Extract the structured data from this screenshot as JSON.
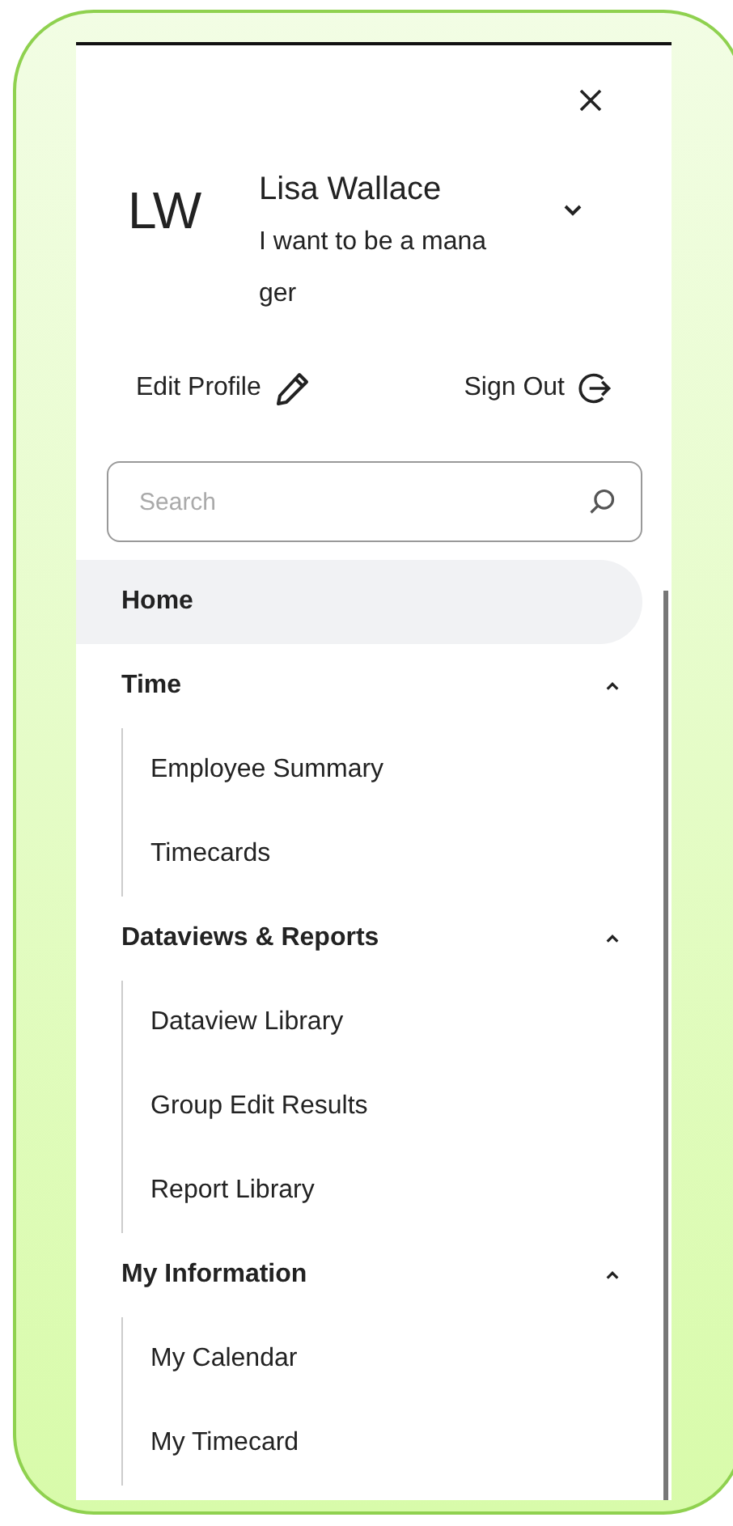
{
  "profile": {
    "initials": "LW",
    "name": "Lisa Wallace",
    "subtitle": "I want to be a manager",
    "expanded": false
  },
  "actions": {
    "edit": "Edit Profile",
    "sign_out": "Sign Out"
  },
  "search": {
    "placeholder": "Search"
  },
  "nav": [
    {
      "kind": "link",
      "label": "Home",
      "selected": true
    },
    {
      "kind": "section",
      "label": "Time",
      "selected": false,
      "expanded": true,
      "children": [
        {
          "label": "Employee Summary",
          "selected": false
        },
        {
          "label": "Timecards",
          "selected": false
        }
      ]
    },
    {
      "kind": "section",
      "label": "Dataviews & Reports",
      "selected": false,
      "expanded": true,
      "children": [
        {
          "label": "Dataview Library",
          "selected": false
        },
        {
          "label": "Group Edit Results",
          "selected": false
        },
        {
          "label": "Report Library",
          "selected": false
        }
      ]
    },
    {
      "kind": "section",
      "label": "My Information",
      "selected": false,
      "expanded": true,
      "children": [
        {
          "label": "My Calendar",
          "selected": false
        },
        {
          "label": "My Timecard",
          "selected": false
        }
      ]
    }
  ]
}
